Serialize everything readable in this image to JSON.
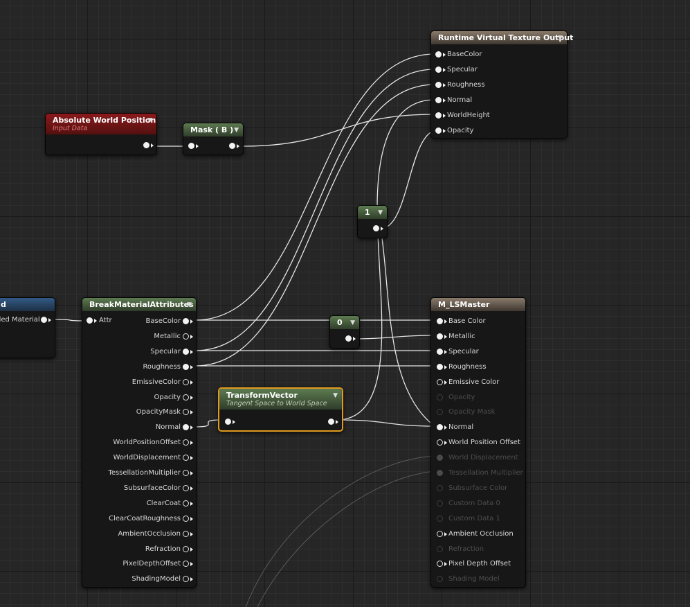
{
  "colors": {
    "wire": "#e6e6e6",
    "wire_dim": "#5a5a5a",
    "selected_border": "#e39a1c",
    "function_header": "#5d7b50",
    "input_header": "#8a1a1c",
    "output_header": "#8a7b6b"
  },
  "graph": {
    "rvt_output": {
      "title": "Runtime Virtual Texture Output",
      "inputs": [
        "BaseColor",
        "Specular",
        "Roughness",
        "Normal",
        "WorldHeight",
        "Opacity"
      ]
    },
    "abs_world_pos": {
      "title": "Absolute World Position",
      "subtitle": "Input Data"
    },
    "mask": {
      "title": "Mask ( B )"
    },
    "const_one": {
      "value": "1"
    },
    "const_zero": {
      "value": "0"
    },
    "make_attr": {
      "title": "d",
      "output": "ded Material"
    },
    "break_attr": {
      "title": "BreakMaterialAttributes",
      "input": "Attr",
      "outputs": [
        "BaseColor",
        "Metallic",
        "Specular",
        "Roughness",
        "EmissiveColor",
        "Opacity",
        "OpacityMask",
        "Normal",
        "WorldPositionOffset",
        "WorldDisplacement",
        "TessellationMultiplier",
        "SubsurfaceColor",
        "ClearCoat",
        "ClearCoatRoughness",
        "AmbientOcclusion",
        "Refraction",
        "PixelDepthOffset",
        "ShadingModel"
      ]
    },
    "transform_vector": {
      "title": "TransformVector",
      "subtitle": "Tangent Space to World Space"
    },
    "master": {
      "title": "M_LSMaster",
      "inputs": [
        "Base Color",
        "Metallic",
        "Specular",
        "Roughness",
        "Emissive Color",
        "Opacity",
        "Opacity Mask",
        "Normal",
        "World Position Offset",
        "World Displacement",
        "Tessellation Multiplier",
        "Subsurface Color",
        "Custom Data 0",
        "Custom Data 1",
        "Ambient Occlusion",
        "Refraction",
        "Pixel Depth Offset",
        "Shading Model"
      ]
    }
  }
}
